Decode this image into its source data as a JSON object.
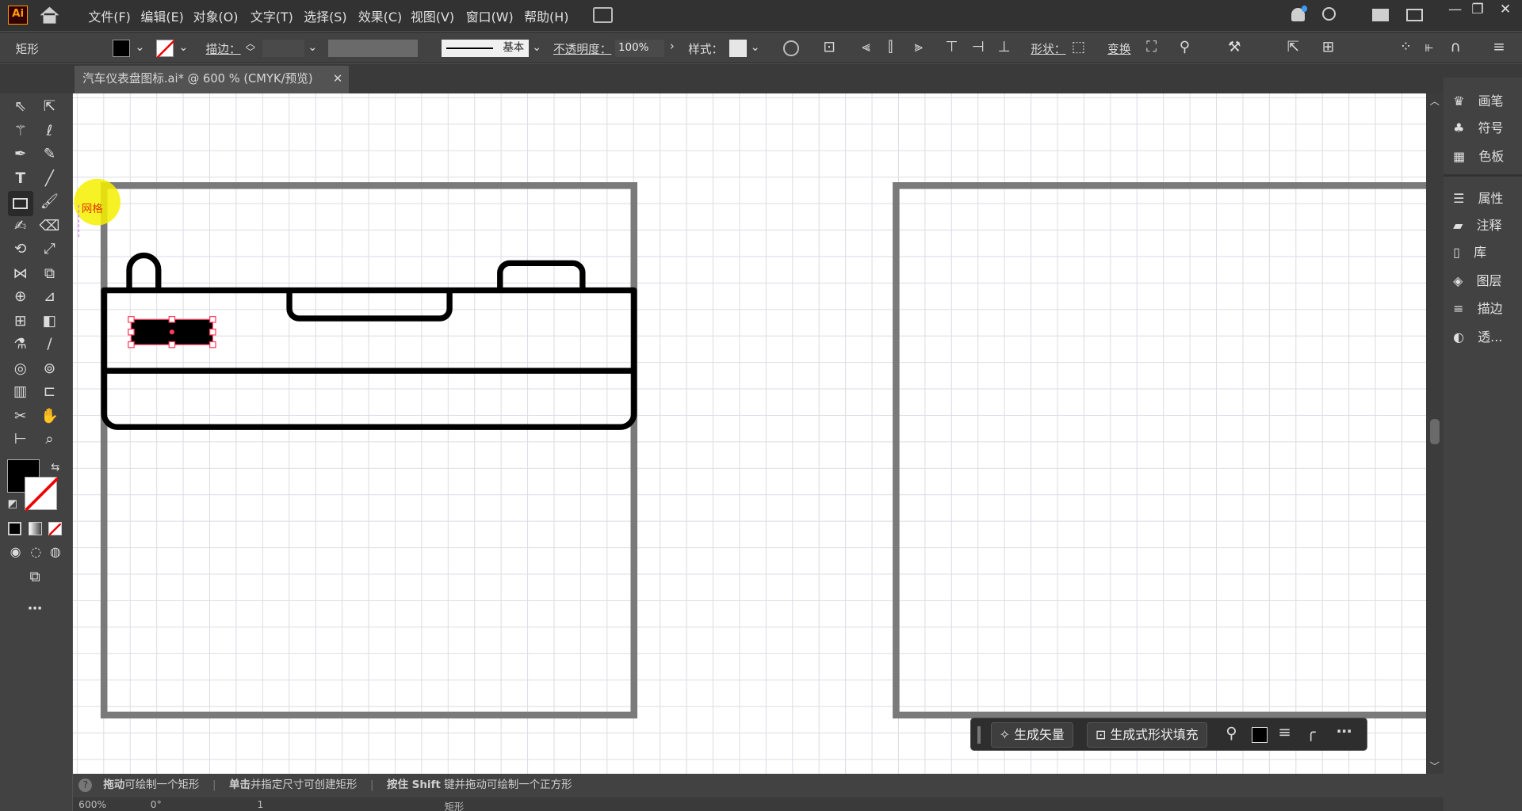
{
  "app": {
    "logo": "Ai",
    "menus": [
      "文件(F)",
      "编辑(E)",
      "对象(O)",
      "文字(T)",
      "选择(S)",
      "效果(C)",
      "视图(V)",
      "窗口(W)",
      "帮助(H)"
    ]
  },
  "control": {
    "tool_name": "矩形",
    "stroke_label": "描边：",
    "stroke_style": "基本",
    "opacity_label": "不透明度：",
    "opacity_value": "100%",
    "style_label": "样式：",
    "shape_label": "形状：",
    "transform_label": "变换"
  },
  "document": {
    "tab_title": "汽车仪表盘图标.ai* @ 600 % (CMYK/预览)"
  },
  "panels": [
    "画笔",
    "符号",
    "色板",
    "属性",
    "注释",
    "库",
    "图层",
    "描边",
    "透..."
  ],
  "status": {
    "hint1_bold": "拖动",
    "hint1": "可绘制一个矩形",
    "hint2_bold": "单击",
    "hint2": "并指定尺寸可创建矩形",
    "hint3_pre": "按住 ",
    "hint3_key": "Shift",
    "hint3_mid": " 键并拖动",
    "hint3": "可绘制一个正方形"
  },
  "bottom": {
    "zoom": "600%",
    "rotate": "0°",
    "artboard": "1",
    "tool": "矩形"
  },
  "context": {
    "gen_vector": "生成矢量",
    "gen_fill": "生成式形状填充"
  },
  "cursor_label": "网格",
  "colors": {
    "accent": "#ff9a00",
    "ui_dark": "#323232",
    "panel": "#424242"
  }
}
